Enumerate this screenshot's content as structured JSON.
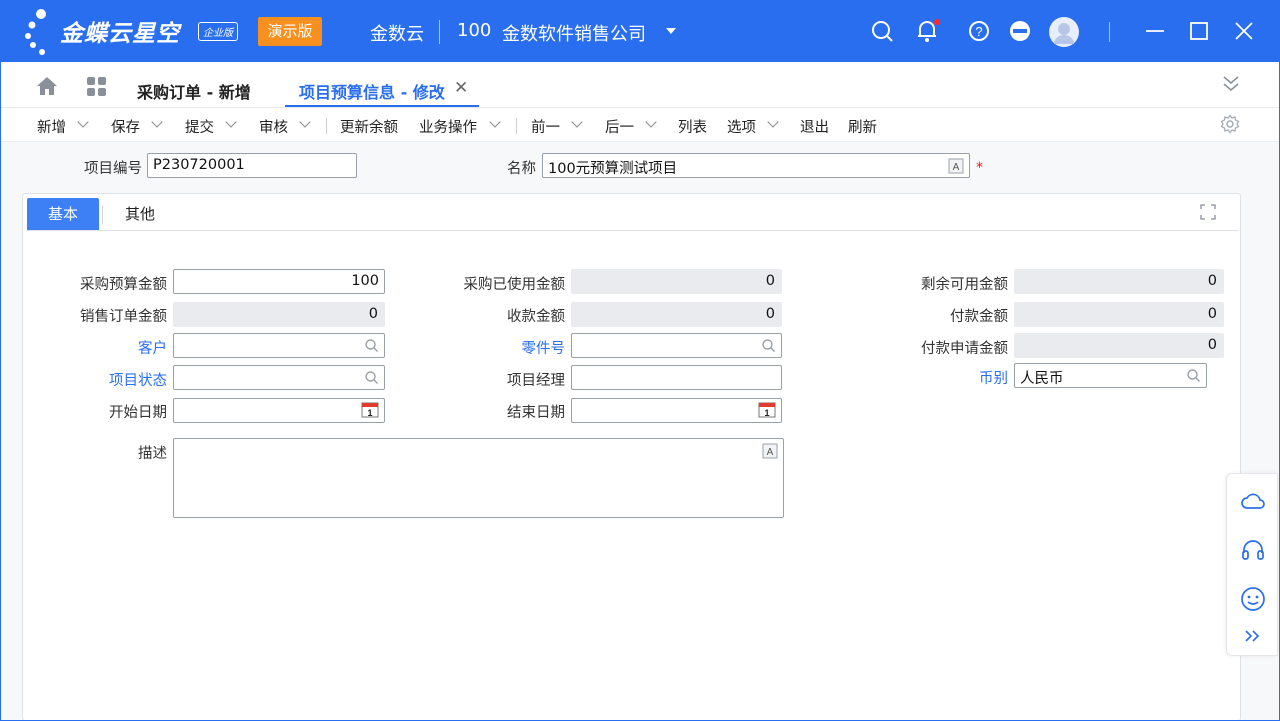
{
  "titlebar": {
    "brand": "金蝶云星空",
    "brand_badge": "企业版",
    "demo_label": "演示版",
    "cloud_name": "金数云",
    "org_code": "100",
    "org_name": "金数软件销售公司",
    "color": "#2a6ef0"
  },
  "tabs": {
    "items": [
      {
        "label": "采购订单 - 新增"
      },
      {
        "label": "项目预算信息 - 修改"
      }
    ]
  },
  "toolbar": {
    "buttons": [
      {
        "label": "新增"
      },
      {
        "label": "保存"
      },
      {
        "label": "提交"
      },
      {
        "label": "审核"
      },
      {
        "label": "更新余额"
      },
      {
        "label": "业务操作"
      },
      {
        "label": "前一"
      },
      {
        "label": "后一"
      },
      {
        "label": "列表"
      },
      {
        "label": "选项"
      },
      {
        "label": "退出"
      },
      {
        "label": "刷新"
      }
    ]
  },
  "header_form": {
    "project_code_label": "项目编号",
    "project_code_value": "P230720001",
    "name_label": "名称",
    "name_value": "100元预算测试项目",
    "required_mark": "*"
  },
  "panel": {
    "tabs": [
      {
        "label": "基本"
      },
      {
        "label": "其他"
      }
    ],
    "fields": {
      "purchase_budget": {
        "label": "采购预算金额",
        "value": "100"
      },
      "purchase_used": {
        "label": "采购已使用金额",
        "value": "0"
      },
      "remaining": {
        "label": "剩余可用金额",
        "value": "0"
      },
      "sales_order": {
        "label": "销售订单金额",
        "value": "0"
      },
      "receipt": {
        "label": "收款金额",
        "value": "0"
      },
      "payment": {
        "label": "付款金额",
        "value": "0"
      },
      "customer": {
        "label": "客户",
        "value": ""
      },
      "part_no": {
        "label": "零件号",
        "value": ""
      },
      "payment_request": {
        "label": "付款申请金额",
        "value": "0"
      },
      "project_status": {
        "label": "项目状态",
        "value": ""
      },
      "project_manager": {
        "label": "项目经理",
        "value": ""
      },
      "currency": {
        "label": "币别",
        "value": "人民币"
      },
      "start_date": {
        "label": "开始日期",
        "value": ""
      },
      "end_date": {
        "label": "结束日期",
        "value": ""
      },
      "description": {
        "label": "描述",
        "value": ""
      }
    }
  }
}
